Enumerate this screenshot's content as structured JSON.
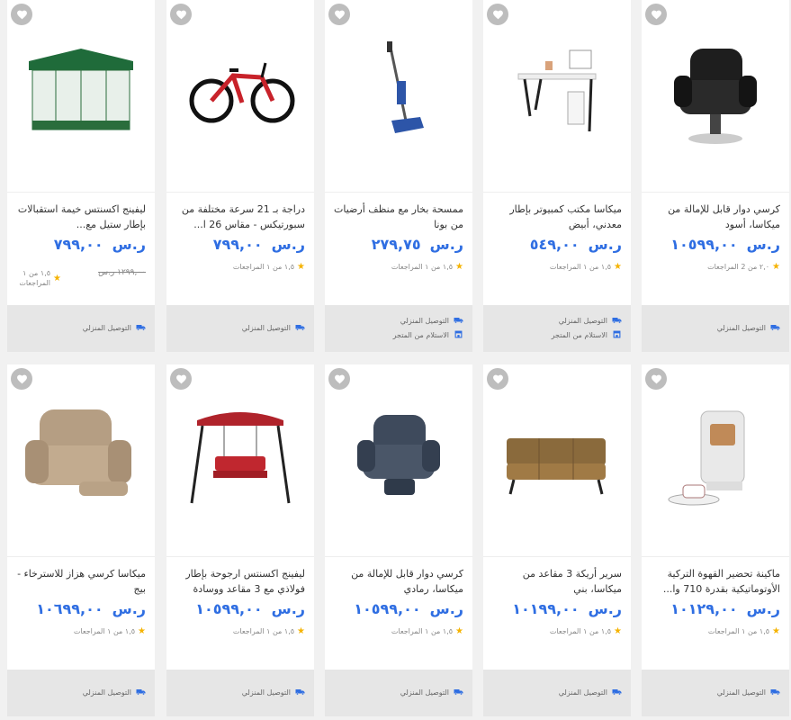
{
  "accent_color": "#2f6ee2",
  "star_color": "#f5b301",
  "options": {
    "home_delivery": "التوصيل المنزلي",
    "store_pickup": "الاستلام من المتجر"
  },
  "products": [
    {
      "title": "كرسي دوار قابل للإمالة من ميكاسا، أسود",
      "currency": "ر.س",
      "price": "١٠٥٩٩,٠٠",
      "old_price": "",
      "rating": "٢,٠ من 2 المراجعات",
      "options": [
        "home_delivery"
      ],
      "thumb": "recliner-black"
    },
    {
      "title": "ميكاسا مكتب كمبيوتر بإطار معدني، أبيض",
      "currency": "ر.س",
      "price": "٥٤٩,٠٠",
      "old_price": "",
      "rating": "١,٥ من ١ المراجعات",
      "options": [
        "home_delivery",
        "store_pickup"
      ],
      "thumb": "desk-white"
    },
    {
      "title": "ممسحة بخار مع منظف أرضيات من بونا",
      "currency": "ر.س",
      "price": "٢٧٩,٧٥",
      "old_price": "",
      "rating": "١,٥ من ١ المراجعات",
      "options": [
        "home_delivery",
        "store_pickup"
      ],
      "thumb": "steam-mop"
    },
    {
      "title": "دراجة بـ 21 سرعة مختلفة من سبورتيكس - مقاس 26 ا...",
      "currency": "ر.س",
      "price": "٧٩٩,٠٠",
      "old_price": "",
      "rating": "١,٥ من ١ المراجعات",
      "options": [
        "home_delivery"
      ],
      "thumb": "bicycle"
    },
    {
      "title": "ليفينج اكسنتس خيمة استقبالات بإطار ستيل مع...",
      "currency": "ر.س",
      "price": "٧٩٩,٠٠",
      "old_price": "١٢٩٩,٠٠ ر.س",
      "rating": "١,٥ من ١ المراجعات",
      "options": [
        "home_delivery"
      ],
      "thumb": "gazebo"
    },
    {
      "title": "ماكينة تحضير القهوة التركية الأوتوماتيكية بقدرة 710 وا...",
      "currency": "ر.س",
      "price": "١٠١٢٩,٠٠",
      "old_price": "",
      "rating": "١,٥ من ١ المراجعات",
      "options": [
        "home_delivery"
      ],
      "thumb": "coffee-machine"
    },
    {
      "title": "سرير أريكة 3 مقاعد من ميكاسا، بني",
      "currency": "ر.س",
      "price": "١٠١٩٩,٠٠",
      "old_price": "",
      "rating": "١,٥ من ١ المراجعات",
      "options": [
        "home_delivery"
      ],
      "thumb": "sofa-bed"
    },
    {
      "title": "كرسي دوار قابل للإمالة من ميكاسا، رمادي",
      "currency": "ر.س",
      "price": "١٠٥٩٩,٠٠",
      "old_price": "",
      "rating": "١,٥ من ١ المراجعات",
      "options": [
        "home_delivery"
      ],
      "thumb": "recliner-grey"
    },
    {
      "title": "ليفينج اكسنتس ارجوحة بإطار فولاذي مع 3 مقاعد ووسادة",
      "currency": "ر.س",
      "price": "١٠٥٩٩,٠٠",
      "old_price": "",
      "rating": "١,٥ من ١ المراجعات",
      "options": [
        "home_delivery"
      ],
      "thumb": "swing"
    },
    {
      "title": "ميكاسا كرسي هزاز للاسترخاء - بيج",
      "currency": "ر.س",
      "price": "١٠٦٩٩,٠٠",
      "old_price": "",
      "rating": "١,٥ من ١ المراجعات",
      "options": [
        "home_delivery"
      ],
      "thumb": "recliner-beige"
    }
  ]
}
